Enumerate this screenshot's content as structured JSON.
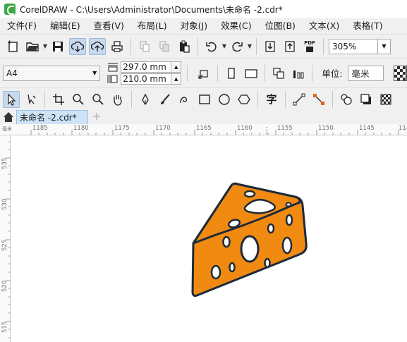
{
  "window": {
    "title": "CorelDRAW - C:\\Users\\Administrator\\Documents\\未命名 -2.cdr*"
  },
  "menu": [
    "文件(F)",
    "编辑(E)",
    "查看(V)",
    "布局(L)",
    "对象(J)",
    "效果(C)",
    "位图(B)",
    "文本(X)",
    "表格(T)"
  ],
  "standard_toolbar": {
    "zoom_value": "305%",
    "buttons": [
      "new-document-icon",
      "open-folder-icon",
      "save-icon",
      "cloud-download-icon",
      "cloud-upload-icon",
      "print-icon",
      "cut-icon",
      "copy-icon",
      "paste-icon",
      "undo-icon",
      "redo-icon",
      "import-icon",
      "export-icon",
      "pdf-icon"
    ],
    "pdf_label": "PDF"
  },
  "property_bar": {
    "page_size": "A4",
    "width": "297.0 mm",
    "height": "210.0 mm",
    "unit_label": "单位:",
    "unit_value": "毫米"
  },
  "toolbox": [
    "pick-tool-icon",
    "shape-tool-icon",
    "crop-tool-icon",
    "zoom-tool-icon",
    "zoom-out-icon",
    "pan-tool-icon",
    "pen-tool-icon",
    "brush-tool-icon",
    "spiral-tool-icon",
    "rectangle-tool-icon",
    "ellipse-tool-icon",
    "polygon-tool-icon",
    "text-tool-icon",
    "line-tool-icon",
    "connector-tool-icon",
    "fill-tool-icon",
    "shadow-tool-icon",
    "transparency-tool-icon"
  ],
  "text_tool_glyph": "字",
  "document_tab": {
    "label": "未命名 -2.cdr*",
    "add": "+"
  },
  "ruler": {
    "top_labels": [
      "1185",
      "1180",
      "1175",
      "1170",
      "1165",
      "1160",
      "1155",
      "1150",
      "1145",
      "114"
    ],
    "top_corner": "毫米",
    "left_labels": [
      "535",
      "530",
      "525",
      "520",
      "515"
    ]
  },
  "colors": {
    "cheese_fill": "#f08a11",
    "cheese_outline": "#1d2a3a",
    "tab_active": "#cde4f7",
    "chrome": "#f0f0f0"
  }
}
